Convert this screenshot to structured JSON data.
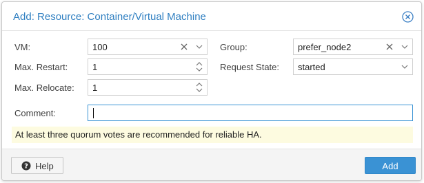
{
  "dialog": {
    "title": "Add: Resource: Container/Virtual Machine"
  },
  "form": {
    "vm": {
      "label": "VM:",
      "value": "100"
    },
    "max_restart": {
      "label": "Max. Restart:",
      "value": "1"
    },
    "max_relocate": {
      "label": "Max. Relocate:",
      "value": "1"
    },
    "group": {
      "label": "Group:",
      "value": "prefer_node2"
    },
    "request_state": {
      "label": "Request State:",
      "value": "started"
    },
    "comment": {
      "label": "Comment:",
      "value": ""
    }
  },
  "info": {
    "message": "At least three quorum votes are recommended for reliable HA."
  },
  "footer": {
    "help_label": "Help",
    "add_label": "Add"
  },
  "colors": {
    "accent": "#3a92d4",
    "title": "#2f7fc1",
    "info_background": "#fdfbe0"
  }
}
